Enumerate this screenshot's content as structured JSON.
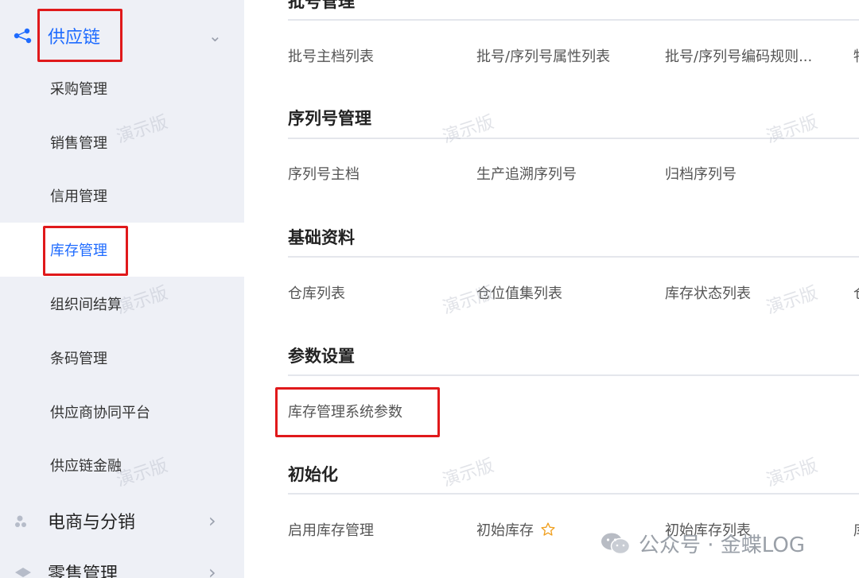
{
  "sidebar": {
    "supply_chain": {
      "label": "供应链",
      "icon": "supply-chain-icon",
      "expanded": true
    },
    "items": [
      {
        "label": "采购管理"
      },
      {
        "label": "销售管理"
      },
      {
        "label": "信用管理"
      },
      {
        "label": "库存管理",
        "selected": true
      },
      {
        "label": "组织间结算"
      },
      {
        "label": "条码管理"
      },
      {
        "label": "供应商协同平台"
      },
      {
        "label": "供应链金融"
      }
    ],
    "ecommerce": {
      "label": "电商与分销",
      "icon": "ecommerce-icon"
    },
    "retail": {
      "label": "零售管理",
      "icon": "retail-icon"
    }
  },
  "main": {
    "batch": {
      "title": "批号管理",
      "links": [
        "批号主档列表",
        "批号/序列号属性列表",
        "批号/序列号编码规则...",
        "物"
      ]
    },
    "serial": {
      "title": "序列号管理",
      "links": [
        "序列号主档",
        "生产追溯序列号",
        "归档序列号"
      ]
    },
    "basic": {
      "title": "基础资料",
      "links": [
        "仓库列表",
        "仓位值集列表",
        "库存状态列表",
        "仓"
      ]
    },
    "params": {
      "title": "参数设置",
      "links": [
        "库存管理系统参数"
      ]
    },
    "init": {
      "title": "初始化",
      "links": [
        "启用库存管理",
        "初始库存",
        "初始库存列表",
        "库"
      ]
    }
  },
  "watermark_text": "演示版",
  "brand": {
    "text": "公众号 · 金蝶LOG"
  },
  "colors": {
    "accent": "#1e6bff",
    "highlight": "#e0191b",
    "sidebar_bg": "#eef0f6"
  }
}
